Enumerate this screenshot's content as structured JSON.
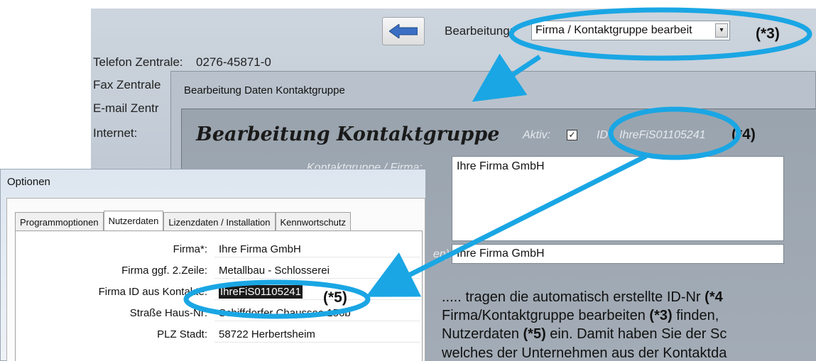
{
  "back_window": {
    "edit_label": "Bearbeitung:",
    "edit_select_value": "Firma / Kontaktgruppe bearbeit",
    "fields": [
      {
        "label": "Telefon Zentrale:",
        "value": "0276-45871-0"
      },
      {
        "label": "Fax Zentrale",
        "value": ""
      },
      {
        "label": "E-mail Zentr",
        "value": ""
      },
      {
        "label": "Internet:",
        "value": ""
      }
    ]
  },
  "kontakt_dialog": {
    "title": "Bearbeitung Daten Kontaktgruppe",
    "heading": "Bearbeitung Kontaktgruppe",
    "aktiv_label": "Aktiv:",
    "aktiv_checked": "☑",
    "id_label": "ID",
    "id_value": "IhreFiS01105241",
    "kontaktgruppe_label": "Kontaktgruppe / Firma:",
    "kontaktgruppe_value": "Ihre Firma GmbH",
    "second_label": "en)",
    "second_value": "Ihre Firma GmbH"
  },
  "optionen_dialog": {
    "title": "Optionen",
    "tabs": [
      "Programmoptionen",
      "Nutzerdaten",
      "Lizenzdaten / Installation",
      "Kennwortschutz"
    ],
    "active_tab": "Nutzerdaten",
    "rows": [
      {
        "label": "Firma*:",
        "value": "Ihre Firma GmbH"
      },
      {
        "label": "Firma ggf. 2.Zeile:",
        "value": "Metallbau - Schlosserei"
      },
      {
        "label": "Firma ID aus Kontakte:",
        "value": "IhreFiS01105241"
      },
      {
        "label": "Straße Haus-Nr:",
        "value": "Schiffdorfer Chaussee 156b"
      },
      {
        "label": "PLZ Stadt:",
        "value": "58722 Herbertsheim"
      }
    ]
  },
  "annotations": {
    "a3": "(*3)",
    "a4": "(*4)",
    "a5": "(*5)"
  },
  "caption": {
    "line1_text": "..... tragen die automatisch erstellte ID-Nr ",
    "line1_bold": "(*4",
    "line2_text": "Firma/Kontaktgruppe bearbeiten ",
    "line2_bold": "(*3)",
    "line2_rest": " finden,",
    "line3_text": "Nutzerdaten ",
    "line3_bold": "(*5)",
    "line3_rest": " ein. Damit haben Sie der Sc",
    "line4_text": "welches der Unternehmen aus der Kontaktda"
  },
  "colors": {
    "highlight": "#1aa6e4",
    "back_window": "#c6cfd9",
    "dialog_body": "#9ea8b2"
  }
}
